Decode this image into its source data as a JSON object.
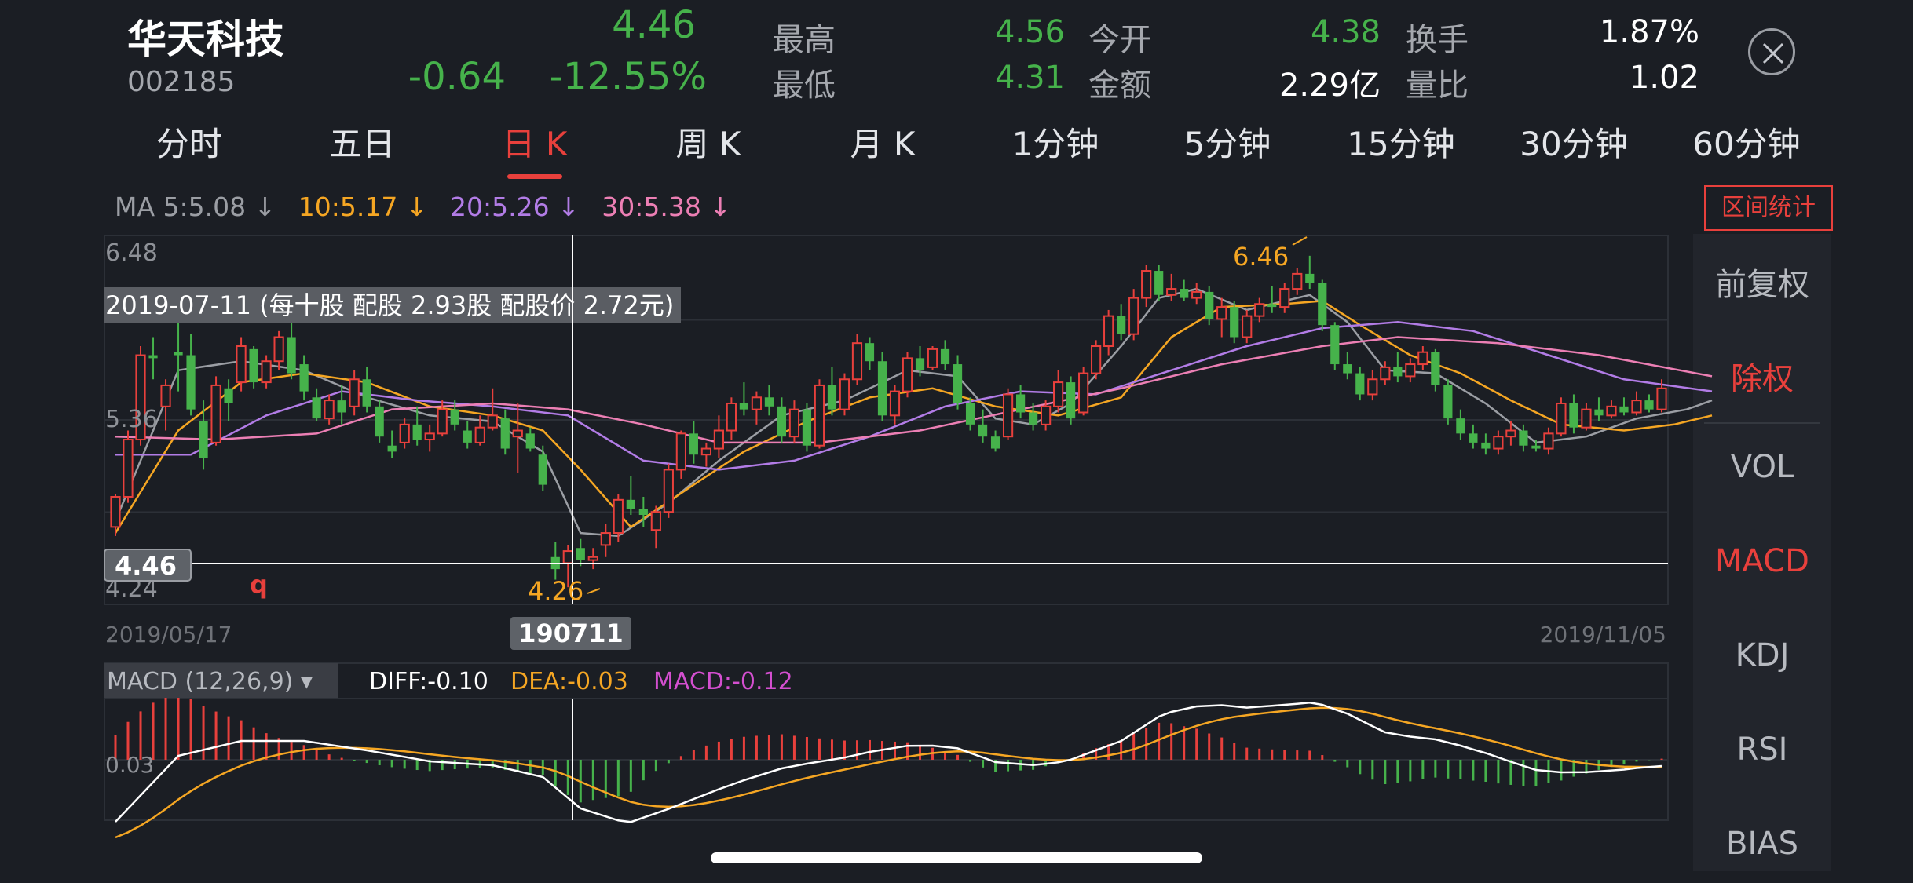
{
  "stock": {
    "name": "华天科技",
    "code": "002185",
    "price": "4.46",
    "change": "-0.64",
    "change_pct": "-12.55%"
  },
  "stats": [
    {
      "label": "最高",
      "value": "4.56",
      "color": "#46b24b"
    },
    {
      "label": "最低",
      "value": "4.31",
      "color": "#46b24b"
    },
    {
      "label": "今开",
      "value": "4.38",
      "color": "#46b24b"
    },
    {
      "label": "金额",
      "value": "2.29亿",
      "color": "#ffffff"
    },
    {
      "label": "换手",
      "value": "1.87%",
      "color": "#ffffff"
    },
    {
      "label": "量比",
      "value": "1.02",
      "color": "#ffffff"
    }
  ],
  "tabs": [
    "分时",
    "五日",
    "日 K",
    "周 K",
    "月 K",
    "1分钟",
    "5分钟",
    "15分钟",
    "30分钟",
    "60分钟"
  ],
  "active_tab": "日 K",
  "ma_legend": [
    {
      "label": "MA 5:5.08 ↓",
      "color": "#9b9ea4"
    },
    {
      "label": "10:5.17 ↓",
      "color": "#f5a623"
    },
    {
      "label": "20:5.26 ↓",
      "color": "#b27ce6"
    },
    {
      "label": "30:5.38 ↓",
      "color": "#ec7fb4"
    }
  ],
  "range_stats_button": "区间统计",
  "side_panel": [
    {
      "label": "前复权",
      "color": "#b7bac0"
    },
    {
      "label": "除权",
      "color": "#e8403c"
    },
    {
      "label": "VOL",
      "color": "#b7bac0"
    },
    {
      "label": "MACD",
      "color": "#e8403c"
    },
    {
      "label": "KDJ",
      "color": "#b7bac0"
    },
    {
      "label": "RSI",
      "color": "#b7bac0"
    },
    {
      "label": "BIAS",
      "color": "#b7bac0"
    }
  ],
  "colors": {
    "up": "#e8403c",
    "down": "#46b24b",
    "background": "#1b1e24",
    "grid": "#2c3037"
  },
  "chart_data": {
    "type": "candlestick",
    "y_axis_labels": [
      "6.48",
      "5.36",
      "4.24"
    ],
    "ylim": [
      4.24,
      6.48
    ],
    "x_labels": [
      "2019/05/17",
      "2019/11/05"
    ],
    "event_annotation": "2019-07-11 (每十股 配股 2.93股 配股价 2.72元)",
    "event_marker": "q",
    "crosshair_price": "4.46",
    "crosshair_date": "190711",
    "high_marker": "6.46",
    "low_marker": "4.26",
    "candles": [
      {
        "o": 4.66,
        "h": 4.88,
        "l": 4.6,
        "c": 4.86
      },
      {
        "o": 4.86,
        "h": 5.3,
        "l": 4.82,
        "c": 5.24
      },
      {
        "o": 5.24,
        "h": 5.86,
        "l": 5.2,
        "c": 5.8
      },
      {
        "o": 5.8,
        "h": 5.92,
        "l": 5.64,
        "c": 5.78
      },
      {
        "o": 5.46,
        "h": 5.64,
        "l": 5.3,
        "c": 5.6
      },
      {
        "o": 5.82,
        "h": 6.1,
        "l": 5.56,
        "c": 5.8
      },
      {
        "o": 5.8,
        "h": 5.94,
        "l": 5.4,
        "c": 5.44
      },
      {
        "o": 5.36,
        "h": 5.5,
        "l": 5.04,
        "c": 5.12
      },
      {
        "o": 5.22,
        "h": 5.66,
        "l": 5.2,
        "c": 5.6
      },
      {
        "o": 5.58,
        "h": 5.64,
        "l": 5.36,
        "c": 5.48
      },
      {
        "o": 5.62,
        "h": 5.92,
        "l": 5.56,
        "c": 5.86
      },
      {
        "o": 5.84,
        "h": 5.86,
        "l": 5.58,
        "c": 5.62
      },
      {
        "o": 5.62,
        "h": 5.8,
        "l": 5.58,
        "c": 5.76
      },
      {
        "o": 5.76,
        "h": 5.96,
        "l": 5.7,
        "c": 5.92
      },
      {
        "o": 5.92,
        "h": 6.02,
        "l": 5.64,
        "c": 5.68
      },
      {
        "o": 5.74,
        "h": 5.8,
        "l": 5.5,
        "c": 5.56
      },
      {
        "o": 5.52,
        "h": 5.58,
        "l": 5.36,
        "c": 5.38
      },
      {
        "o": 5.38,
        "h": 5.54,
        "l": 5.34,
        "c": 5.5
      },
      {
        "o": 5.5,
        "h": 5.6,
        "l": 5.34,
        "c": 5.42
      },
      {
        "o": 5.46,
        "h": 5.7,
        "l": 5.4,
        "c": 5.64
      },
      {
        "o": 5.64,
        "h": 5.72,
        "l": 5.42,
        "c": 5.46
      },
      {
        "o": 5.46,
        "h": 5.5,
        "l": 5.22,
        "c": 5.26
      },
      {
        "o": 5.2,
        "h": 5.3,
        "l": 5.12,
        "c": 5.16
      },
      {
        "o": 5.22,
        "h": 5.38,
        "l": 5.18,
        "c": 5.34
      },
      {
        "o": 5.34,
        "h": 5.46,
        "l": 5.2,
        "c": 5.24
      },
      {
        "o": 5.24,
        "h": 5.34,
        "l": 5.16,
        "c": 5.28
      },
      {
        "o": 5.28,
        "h": 5.5,
        "l": 5.26,
        "c": 5.44
      },
      {
        "o": 5.44,
        "h": 5.5,
        "l": 5.3,
        "c": 5.34
      },
      {
        "o": 5.3,
        "h": 5.36,
        "l": 5.18,
        "c": 5.22
      },
      {
        "o": 5.22,
        "h": 5.4,
        "l": 5.2,
        "c": 5.32
      },
      {
        "o": 5.32,
        "h": 5.58,
        "l": 5.3,
        "c": 5.4
      },
      {
        "o": 5.38,
        "h": 5.44,
        "l": 5.14,
        "c": 5.18
      },
      {
        "o": 5.26,
        "h": 5.48,
        "l": 5.02,
        "c": 5.3
      },
      {
        "o": 5.28,
        "h": 5.32,
        "l": 5.16,
        "c": 5.18
      },
      {
        "o": 5.14,
        "h": 5.2,
        "l": 4.9,
        "c": 4.94
      },
      {
        "o": 4.46,
        "h": 4.56,
        "l": 4.31,
        "c": 4.38
      },
      {
        "o": 4.42,
        "h": 4.54,
        "l": 4.26,
        "c": 4.5
      },
      {
        "o": 4.52,
        "h": 4.58,
        "l": 4.4,
        "c": 4.44
      },
      {
        "o": 4.44,
        "h": 4.52,
        "l": 4.38,
        "c": 4.46
      },
      {
        "o": 4.54,
        "h": 4.68,
        "l": 4.46,
        "c": 4.62
      },
      {
        "o": 4.62,
        "h": 4.88,
        "l": 4.56,
        "c": 4.84
      },
      {
        "o": 4.84,
        "h": 5.0,
        "l": 4.74,
        "c": 4.78
      },
      {
        "o": 4.78,
        "h": 4.86,
        "l": 4.66,
        "c": 4.74
      },
      {
        "o": 4.64,
        "h": 4.8,
        "l": 4.52,
        "c": 4.76
      },
      {
        "o": 4.76,
        "h": 5.08,
        "l": 4.72,
        "c": 5.04
      },
      {
        "o": 5.04,
        "h": 5.3,
        "l": 4.98,
        "c": 5.28
      },
      {
        "o": 5.28,
        "h": 5.36,
        "l": 5.08,
        "c": 5.14
      },
      {
        "o": 5.14,
        "h": 5.22,
        "l": 5.06,
        "c": 5.18
      },
      {
        "o": 5.18,
        "h": 5.4,
        "l": 5.12,
        "c": 5.3
      },
      {
        "o": 5.3,
        "h": 5.52,
        "l": 5.24,
        "c": 5.48
      },
      {
        "o": 5.48,
        "h": 5.62,
        "l": 5.4,
        "c": 5.44
      },
      {
        "o": 5.44,
        "h": 5.56,
        "l": 5.34,
        "c": 5.52
      },
      {
        "o": 5.52,
        "h": 5.6,
        "l": 5.4,
        "c": 5.46
      },
      {
        "o": 5.46,
        "h": 5.52,
        "l": 5.22,
        "c": 5.26
      },
      {
        "o": 5.26,
        "h": 5.5,
        "l": 5.22,
        "c": 5.44
      },
      {
        "o": 5.44,
        "h": 5.48,
        "l": 5.16,
        "c": 5.2
      },
      {
        "o": 5.2,
        "h": 5.64,
        "l": 5.18,
        "c": 5.6
      },
      {
        "o": 5.6,
        "h": 5.72,
        "l": 5.4,
        "c": 5.44
      },
      {
        "o": 5.44,
        "h": 5.68,
        "l": 5.4,
        "c": 5.64
      },
      {
        "o": 5.64,
        "h": 5.94,
        "l": 5.6,
        "c": 5.88
      },
      {
        "o": 5.88,
        "h": 5.92,
        "l": 5.7,
        "c": 5.76
      },
      {
        "o": 5.76,
        "h": 5.82,
        "l": 5.36,
        "c": 5.4
      },
      {
        "o": 5.4,
        "h": 5.6,
        "l": 5.34,
        "c": 5.56
      },
      {
        "o": 5.56,
        "h": 5.82,
        "l": 5.52,
        "c": 5.78
      },
      {
        "o": 5.78,
        "h": 5.86,
        "l": 5.66,
        "c": 5.7
      },
      {
        "o": 5.72,
        "h": 5.86,
        "l": 5.7,
        "c": 5.84
      },
      {
        "o": 5.84,
        "h": 5.9,
        "l": 5.7,
        "c": 5.74
      },
      {
        "o": 5.74,
        "h": 5.8,
        "l": 5.44,
        "c": 5.48
      },
      {
        "o": 5.48,
        "h": 5.52,
        "l": 5.3,
        "c": 5.34
      },
      {
        "o": 5.34,
        "h": 5.44,
        "l": 5.22,
        "c": 5.26
      },
      {
        "o": 5.26,
        "h": 5.3,
        "l": 5.16,
        "c": 5.18
      },
      {
        "o": 5.26,
        "h": 5.58,
        "l": 5.24,
        "c": 5.54
      },
      {
        "o": 5.54,
        "h": 5.6,
        "l": 5.38,
        "c": 5.42
      },
      {
        "o": 5.42,
        "h": 5.48,
        "l": 5.3,
        "c": 5.34
      },
      {
        "o": 5.34,
        "h": 5.5,
        "l": 5.3,
        "c": 5.46
      },
      {
        "o": 5.46,
        "h": 5.7,
        "l": 5.42,
        "c": 5.62
      },
      {
        "o": 5.62,
        "h": 5.66,
        "l": 5.34,
        "c": 5.38
      },
      {
        "o": 5.42,
        "h": 5.72,
        "l": 5.4,
        "c": 5.68
      },
      {
        "o": 5.68,
        "h": 5.9,
        "l": 5.64,
        "c": 5.86
      },
      {
        "o": 5.86,
        "h": 6.1,
        "l": 5.8,
        "c": 6.06
      },
      {
        "o": 6.06,
        "h": 6.14,
        "l": 5.9,
        "c": 5.94
      },
      {
        "o": 5.94,
        "h": 6.24,
        "l": 5.9,
        "c": 6.18
      },
      {
        "o": 6.18,
        "h": 6.4,
        "l": 6.12,
        "c": 6.36
      },
      {
        "o": 6.36,
        "h": 6.4,
        "l": 6.16,
        "c": 6.2
      },
      {
        "o": 6.2,
        "h": 6.34,
        "l": 6.16,
        "c": 6.24
      },
      {
        "o": 6.24,
        "h": 6.3,
        "l": 6.16,
        "c": 6.18
      },
      {
        "o": 6.18,
        "h": 6.28,
        "l": 6.14,
        "c": 6.22
      },
      {
        "o": 6.22,
        "h": 6.26,
        "l": 6.0,
        "c": 6.04
      },
      {
        "o": 6.04,
        "h": 6.18,
        "l": 5.92,
        "c": 6.12
      },
      {
        "o": 6.12,
        "h": 6.16,
        "l": 5.88,
        "c": 5.92
      },
      {
        "o": 5.92,
        "h": 6.1,
        "l": 5.88,
        "c": 6.06
      },
      {
        "o": 6.06,
        "h": 6.18,
        "l": 6.02,
        "c": 6.14
      },
      {
        "o": 6.14,
        "h": 6.26,
        "l": 6.08,
        "c": 6.12
      },
      {
        "o": 6.12,
        "h": 6.28,
        "l": 6.08,
        "c": 6.24
      },
      {
        "o": 6.24,
        "h": 6.38,
        "l": 6.2,
        "c": 6.34
      },
      {
        "o": 6.34,
        "h": 6.46,
        "l": 6.24,
        "c": 6.28
      },
      {
        "o": 6.28,
        "h": 6.3,
        "l": 5.96,
        "c": 6.0
      },
      {
        "o": 6.0,
        "h": 6.02,
        "l": 5.7,
        "c": 5.74
      },
      {
        "o": 5.74,
        "h": 5.82,
        "l": 5.64,
        "c": 5.68
      },
      {
        "o": 5.68,
        "h": 5.72,
        "l": 5.5,
        "c": 5.54
      },
      {
        "o": 5.54,
        "h": 5.7,
        "l": 5.5,
        "c": 5.64
      },
      {
        "o": 5.64,
        "h": 5.76,
        "l": 5.6,
        "c": 5.72
      },
      {
        "o": 5.72,
        "h": 5.82,
        "l": 5.62,
        "c": 5.66
      },
      {
        "o": 5.66,
        "h": 5.78,
        "l": 5.62,
        "c": 5.74
      },
      {
        "o": 5.74,
        "h": 5.86,
        "l": 5.7,
        "c": 5.82
      },
      {
        "o": 5.82,
        "h": 5.84,
        "l": 5.56,
        "c": 5.6
      },
      {
        "o": 5.6,
        "h": 5.64,
        "l": 5.34,
        "c": 5.38
      },
      {
        "o": 5.38,
        "h": 5.44,
        "l": 5.24,
        "c": 5.28
      },
      {
        "o": 5.28,
        "h": 5.34,
        "l": 5.18,
        "c": 5.22
      },
      {
        "o": 5.22,
        "h": 5.28,
        "l": 5.14,
        "c": 5.18
      },
      {
        "o": 5.18,
        "h": 5.3,
        "l": 5.14,
        "c": 5.26
      },
      {
        "o": 5.26,
        "h": 5.36,
        "l": 5.2,
        "c": 5.3
      },
      {
        "o": 5.3,
        "h": 5.34,
        "l": 5.16,
        "c": 5.2
      },
      {
        "o": 5.2,
        "h": 5.24,
        "l": 5.16,
        "c": 5.18
      },
      {
        "o": 5.18,
        "h": 5.32,
        "l": 5.14,
        "c": 5.28
      },
      {
        "o": 5.28,
        "h": 5.52,
        "l": 5.26,
        "c": 5.48
      },
      {
        "o": 5.48,
        "h": 5.54,
        "l": 5.28,
        "c": 5.32
      },
      {
        "o": 5.32,
        "h": 5.48,
        "l": 5.3,
        "c": 5.44
      },
      {
        "o": 5.44,
        "h": 5.52,
        "l": 5.36,
        "c": 5.4
      },
      {
        "o": 5.4,
        "h": 5.5,
        "l": 5.38,
        "c": 5.46
      },
      {
        "o": 5.46,
        "h": 5.52,
        "l": 5.4,
        "c": 5.42
      },
      {
        "o": 5.42,
        "h": 5.56,
        "l": 5.4,
        "c": 5.5
      },
      {
        "o": 5.5,
        "h": 5.54,
        "l": 5.42,
        "c": 5.44
      },
      {
        "o": 5.44,
        "h": 5.64,
        "l": 5.42,
        "c": 5.58
      }
    ],
    "ma_lines": [
      {
        "name": "MA5",
        "color": "#9b9ea4",
        "values": [
          [
            0,
            4.7
          ],
          [
            5,
            5.7
          ],
          [
            10,
            5.76
          ],
          [
            15,
            5.7
          ],
          [
            20,
            5.52
          ],
          [
            25,
            5.4
          ],
          [
            30,
            5.36
          ],
          [
            34,
            5.16
          ],
          [
            37,
            4.62
          ],
          [
            40,
            4.6
          ],
          [
            44,
            4.82
          ],
          [
            48,
            5.1
          ],
          [
            53,
            5.4
          ],
          [
            58,
            5.5
          ],
          [
            63,
            5.7
          ],
          [
            67,
            5.66
          ],
          [
            70,
            5.38
          ],
          [
            73,
            5.34
          ],
          [
            76,
            5.48
          ],
          [
            80,
            5.86
          ],
          [
            83,
            6.18
          ],
          [
            86,
            6.24
          ],
          [
            90,
            6.1
          ],
          [
            95,
            6.2
          ],
          [
            98,
            6.02
          ],
          [
            101,
            5.7
          ],
          [
            105,
            5.68
          ],
          [
            109,
            5.48
          ],
          [
            113,
            5.22
          ],
          [
            117,
            5.26
          ],
          [
            121,
            5.38
          ],
          [
            125,
            5.44
          ],
          [
            127,
            5.5
          ]
        ]
      },
      {
        "name": "MA10",
        "color": "#f5a623",
        "values": [
          [
            0,
            4.62
          ],
          [
            5,
            5.3
          ],
          [
            10,
            5.62
          ],
          [
            15,
            5.68
          ],
          [
            20,
            5.62
          ],
          [
            25,
            5.46
          ],
          [
            30,
            5.4
          ],
          [
            34,
            5.3
          ],
          [
            37,
            5.04
          ],
          [
            41,
            4.66
          ],
          [
            46,
            4.94
          ],
          [
            50,
            5.16
          ],
          [
            55,
            5.36
          ],
          [
            60,
            5.52
          ],
          [
            65,
            5.58
          ],
          [
            70,
            5.46
          ],
          [
            75,
            5.4
          ],
          [
            80,
            5.52
          ],
          [
            84,
            5.92
          ],
          [
            88,
            6.12
          ],
          [
            93,
            6.14
          ],
          [
            96,
            6.16
          ],
          [
            99,
            6.0
          ],
          [
            103,
            5.8
          ],
          [
            107,
            5.68
          ],
          [
            111,
            5.5
          ],
          [
            115,
            5.34
          ],
          [
            120,
            5.3
          ],
          [
            124,
            5.34
          ],
          [
            127,
            5.4
          ]
        ]
      },
      {
        "name": "MA20",
        "color": "#b27ce6",
        "values": [
          [
            0,
            5.14
          ],
          [
            6,
            5.14
          ],
          [
            12,
            5.4
          ],
          [
            18,
            5.56
          ],
          [
            24,
            5.5
          ],
          [
            30,
            5.46
          ],
          [
            36,
            5.4
          ],
          [
            42,
            5.1
          ],
          [
            48,
            5.04
          ],
          [
            54,
            5.1
          ],
          [
            60,
            5.26
          ],
          [
            66,
            5.46
          ],
          [
            72,
            5.56
          ],
          [
            78,
            5.54
          ],
          [
            84,
            5.7
          ],
          [
            90,
            5.86
          ],
          [
            96,
            5.98
          ],
          [
            102,
            6.02
          ],
          [
            108,
            5.96
          ],
          [
            114,
            5.8
          ],
          [
            120,
            5.64
          ],
          [
            127,
            5.56
          ]
        ]
      },
      {
        "name": "MA30",
        "color": "#ec7fb4",
        "values": [
          [
            0,
            5.26
          ],
          [
            8,
            5.24
          ],
          [
            16,
            5.28
          ],
          [
            22,
            5.44
          ],
          [
            30,
            5.48
          ],
          [
            36,
            5.44
          ],
          [
            42,
            5.34
          ],
          [
            48,
            5.22
          ],
          [
            56,
            5.22
          ],
          [
            64,
            5.3
          ],
          [
            72,
            5.44
          ],
          [
            80,
            5.58
          ],
          [
            88,
            5.74
          ],
          [
            96,
            5.86
          ],
          [
            102,
            5.92
          ],
          [
            110,
            5.88
          ],
          [
            118,
            5.8
          ],
          [
            127,
            5.66
          ]
        ]
      }
    ]
  },
  "macd": {
    "selector": "MACD (12,26,9) ▾",
    "diff_label": "DIFF:-0.10",
    "dea_label": "DEA:-0.03",
    "macd_label": "MACD:-0.12",
    "y_label": "0.03"
  }
}
